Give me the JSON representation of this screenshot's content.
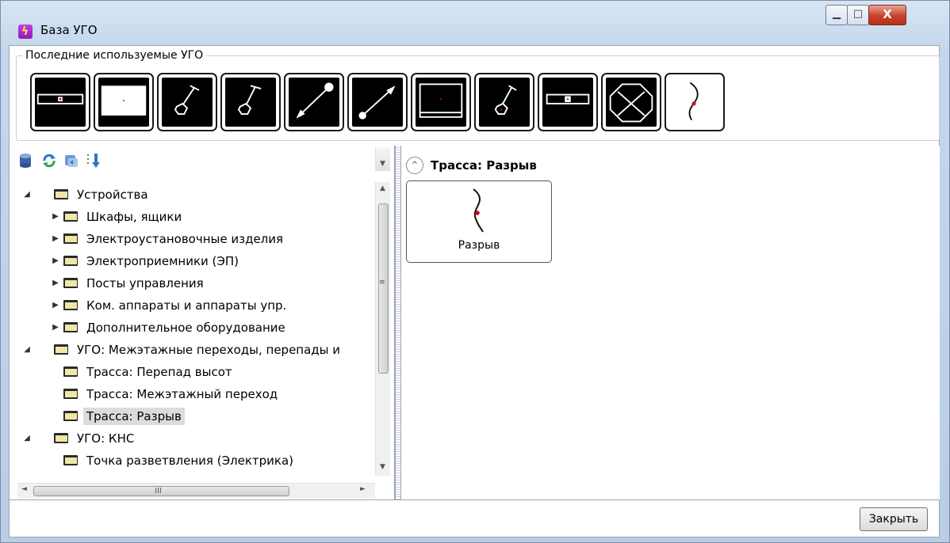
{
  "window": {
    "title": "База УГО",
    "controls": {
      "minimize": "▁",
      "maximize": "□",
      "close": "X"
    }
  },
  "recent": {
    "title": "Последние используемые УГО",
    "items": [
      {
        "name": "symbol-cabinet-rect"
      },
      {
        "name": "symbol-panel-white"
      },
      {
        "name": "symbol-lamp-pole"
      },
      {
        "name": "symbol-lamp-pole-2"
      },
      {
        "name": "symbol-arrow-up"
      },
      {
        "name": "symbol-arrow-down"
      },
      {
        "name": "symbol-double-frame"
      },
      {
        "name": "symbol-hexagon-pole"
      },
      {
        "name": "symbol-cabinet-arrow"
      },
      {
        "name": "symbol-octagon-cross"
      },
      {
        "name": "symbol-break"
      }
    ]
  },
  "toolbar": {
    "icons": [
      "database-icon",
      "refresh-icon",
      "sync-icon",
      "sort-icon"
    ]
  },
  "tree": {
    "rows": [
      {
        "label": "Устройства",
        "level": 0,
        "expanded": true
      },
      {
        "label": "Шкафы, ящики",
        "level": 1,
        "expanded": false
      },
      {
        "label": "Электроустановочные изделия",
        "level": 1,
        "expanded": false
      },
      {
        "label": "Электроприемники (ЭП)",
        "level": 1,
        "expanded": false
      },
      {
        "label": "Посты управления",
        "level": 1,
        "expanded": false
      },
      {
        "label": "Ком. аппараты и аппараты упр.",
        "level": 1,
        "expanded": false
      },
      {
        "label": "Дополнительное оборудование",
        "level": 1,
        "expanded": false
      },
      {
        "label": "УГО: Межэтажные переходы, перепады и",
        "level": 0,
        "expanded": true
      },
      {
        "label": "Трасса: Перепад высот",
        "level": 1,
        "expanded": null
      },
      {
        "label": "Трасса: Межэтажный переход",
        "level": 1,
        "expanded": null
      },
      {
        "label": "Трасса: Разрыв",
        "level": 1,
        "expanded": null,
        "selected": true
      },
      {
        "label": "УГО: КНС",
        "level": 0,
        "expanded": true
      },
      {
        "label": "Точка разветвления (Электрика)",
        "level": 1,
        "expanded": null
      }
    ]
  },
  "scrollbar": {
    "grip": "≡",
    "hgrip": "III",
    "up": "▲",
    "down": "▼",
    "left": "◄",
    "right": "►"
  },
  "section": {
    "title": "Трасса: Разрыв",
    "collapse_glyph": "^"
  },
  "card": {
    "label": "Разрыв"
  },
  "footer": {
    "close_label": "Закрыть"
  },
  "colors": {
    "accent_red": "#d0001a",
    "selection": "#dcdcdc"
  }
}
